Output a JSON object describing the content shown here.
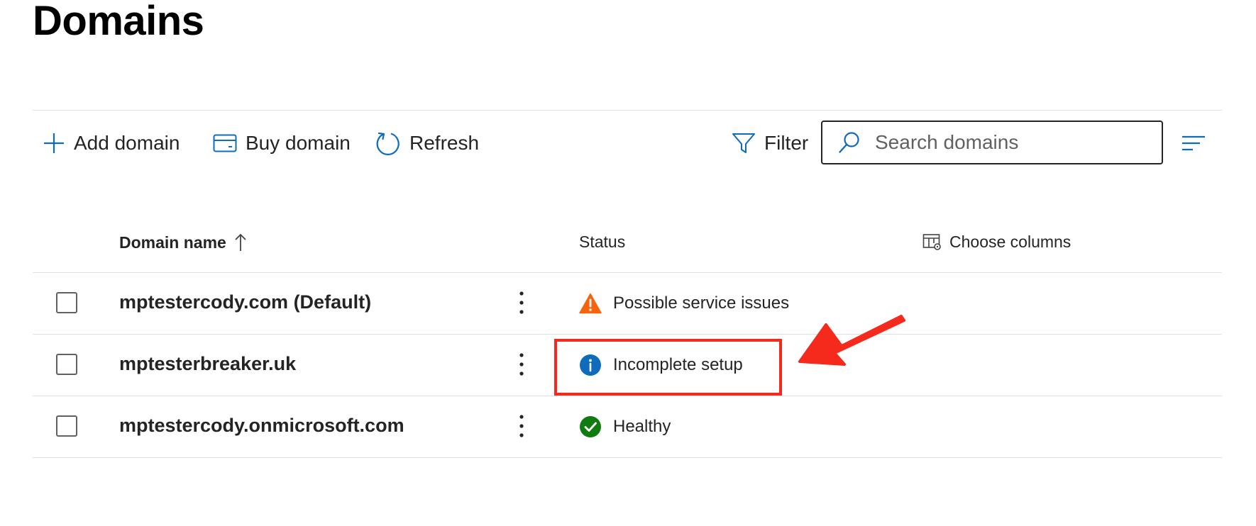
{
  "page": {
    "title": "Domains"
  },
  "toolbar": {
    "add_domain": "Add domain",
    "buy_domain": "Buy domain",
    "refresh": "Refresh",
    "filter": "Filter",
    "search_placeholder": "Search domains"
  },
  "table": {
    "columns": {
      "domain_name": "Domain name",
      "status": "Status",
      "choose_columns": "Choose columns"
    },
    "sort": {
      "column": "Domain name",
      "direction": "ascending"
    },
    "rows": [
      {
        "domain": "mptestercody.com (Default)",
        "status": "Possible service issues",
        "status_icon": "warning-icon"
      },
      {
        "domain": "mptesterbreaker.uk",
        "status": "Incomplete setup",
        "status_icon": "info-icon"
      },
      {
        "domain": "mptestercody.onmicrosoft.com",
        "status": "Healthy",
        "status_icon": "check-circle-icon"
      }
    ]
  },
  "colors": {
    "accent": "#0f6cbd",
    "warning": "#f7630c",
    "info": "#0f6cbd",
    "success": "#107c10",
    "annotation": "#f52a1c"
  }
}
